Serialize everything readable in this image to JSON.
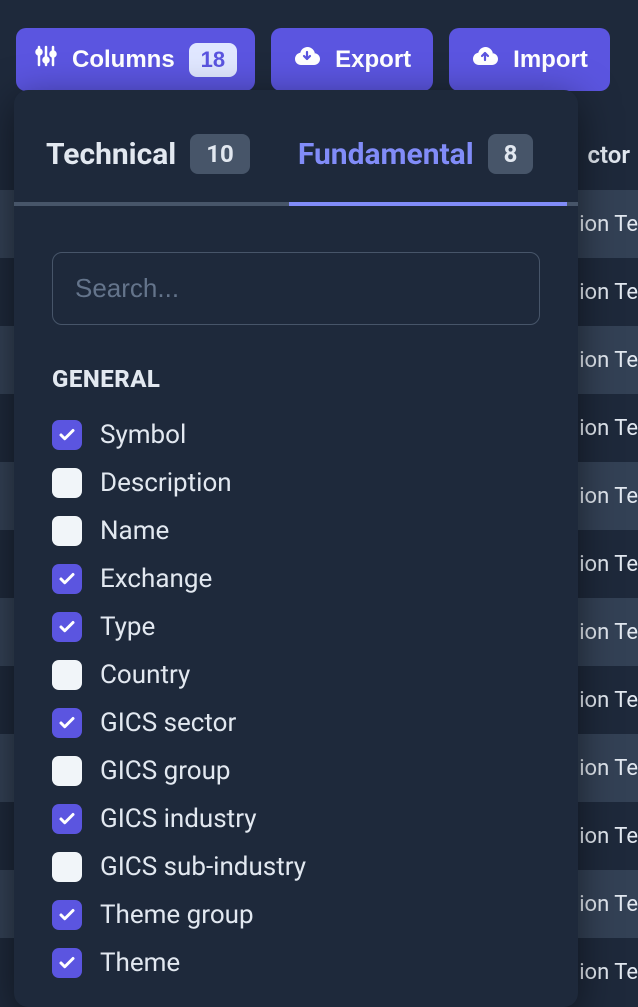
{
  "toolbar": {
    "columns": {
      "label": "Columns",
      "count": "18"
    },
    "export": {
      "label": "Export"
    },
    "import": {
      "label": "Import"
    }
  },
  "dropdown": {
    "tabs": [
      {
        "label": "Technical",
        "count": "10",
        "active": false
      },
      {
        "label": "Fundamental",
        "count": "8",
        "active": true
      }
    ],
    "search": {
      "placeholder": "Search..."
    },
    "sections": [
      {
        "title": "GENERAL",
        "items": [
          {
            "label": "Symbol",
            "checked": true
          },
          {
            "label": "Description",
            "checked": false
          },
          {
            "label": "Name",
            "checked": false
          },
          {
            "label": "Exchange",
            "checked": true
          },
          {
            "label": "Type",
            "checked": true
          },
          {
            "label": "Country",
            "checked": false
          },
          {
            "label": "GICS sector",
            "checked": true
          },
          {
            "label": "GICS group",
            "checked": false
          },
          {
            "label": "GICS industry",
            "checked": true
          },
          {
            "label": "GICS sub-industry",
            "checked": false
          },
          {
            "label": "Theme group",
            "checked": true
          },
          {
            "label": "Theme",
            "checked": true
          }
        ]
      }
    ]
  },
  "table": {
    "header": "ctor",
    "cell": "ion Te"
  }
}
